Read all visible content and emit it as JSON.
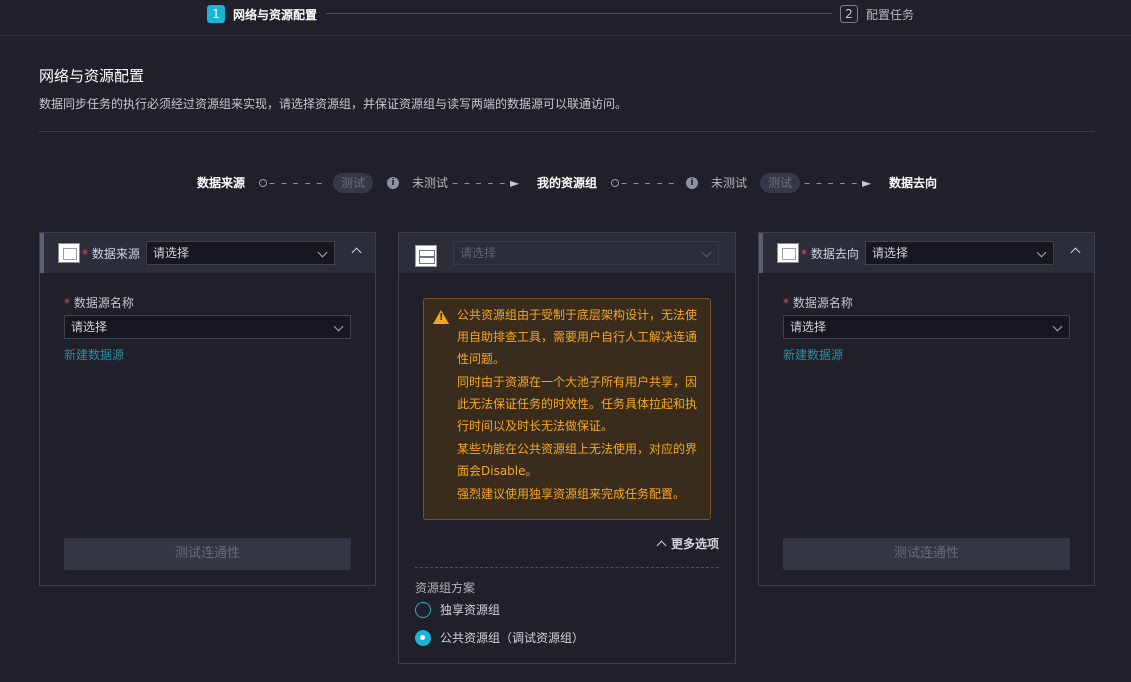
{
  "steps": [
    {
      "num": "1",
      "label": "网络与资源配置"
    },
    {
      "num": "2",
      "label": "配置任务"
    }
  ],
  "page": {
    "title": "网络与资源配置",
    "description": "数据同步任务的执行必须经过资源组来实现，请选择资源组，并保证资源组与读写两端的数据源可以联通访问。"
  },
  "flow": {
    "source_label": "数据来源",
    "test_pill": "测试",
    "untested_left": "未测试",
    "resource_label": "我的资源组",
    "untested_right": "未测试",
    "test_pill_right": "测试",
    "dest_label": "数据去向"
  },
  "source_card": {
    "head_label": "数据来源",
    "head_select": "请选择",
    "field_label": "数据源名称",
    "field_select": "请选择",
    "new_link": "新建数据源",
    "test_button": "测试连通性"
  },
  "resource_card": {
    "select_placeholder": "请选择",
    "warning": [
      "公共资源组由于受制于底层架构设计，无法使用自助排查工具，需要用户自行人工解决连通性问题。",
      "同时由于资源在一个大池子所有用户共享，因此无法保证任务的时效性。任务具体拉起和执行时间以及时长无法做保证。",
      "某些功能在公共资源组上无法使用，对应的界面会Disable。",
      "强烈建议使用独享资源组来完成任务配置。"
    ],
    "more_options": "更多选项",
    "scheme_label": "资源组方案",
    "options": [
      {
        "label": "独享资源组",
        "checked": false
      },
      {
        "label": "公共资源组（调试资源组）",
        "checked": true
      }
    ]
  },
  "dest_card": {
    "head_label": "数据去向",
    "head_select": "请选择",
    "field_label": "数据源名称",
    "field_select": "请选择",
    "new_link": "新建数据源",
    "test_button": "测试连通性"
  },
  "colors": {
    "accent": "#1ab4d6",
    "warning_text": "#f5a623",
    "required": "#f2455a",
    "link": "#2a8fa8"
  }
}
